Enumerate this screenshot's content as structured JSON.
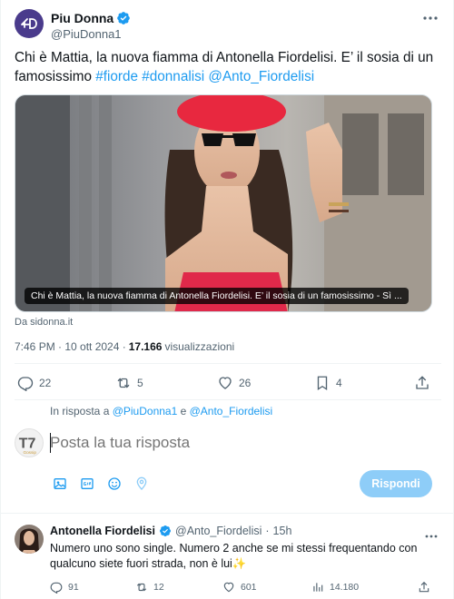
{
  "post": {
    "author_name": "Piu Donna",
    "author_handle": "@PiuDonna1",
    "text_plain": "Chi è Mattia, la nuova fiamma di Antonella Fiordelisi. E’ il sosia di un famosissimo ",
    "tags": [
      "#fiorde",
      "#donnalisi",
      "@Anto_Fiordelisi"
    ],
    "media_caption": "Chi è Mattia, la nuova fiamma di Antonella Fiordelisi. E’ il sosia di un famosissimo - Sì ...",
    "source": "Da sidonna.it",
    "time": "7:46 PM · 10 ott 2024 · ",
    "views_count": "17.166",
    "views_label": "visualizzazioni"
  },
  "actions": {
    "replies": "22",
    "reposts": "5",
    "likes": "26",
    "bookmarks": "4"
  },
  "reply_context": {
    "prefix": "In risposta a ",
    "user1": "@PiuDonna1",
    "conj": " e ",
    "user2": "@Anto_Fiordelisi"
  },
  "compose": {
    "placeholder": "Posta la tua risposta",
    "button_label": "Rispondi",
    "avatar_label": "T7",
    "avatar_sublabel": "Gossip"
  },
  "reply": {
    "author_name": "Antonella Fiordelisi",
    "author_handle": "@Anto_Fiordelisi",
    "separator": " · ",
    "age": "15h",
    "text": "Numero uno sono single. Numero 2 anche se mi stessi frequentando con qualcuno siete fuori strada, non è lui✨",
    "replies": "91",
    "reposts": "12",
    "likes": "601",
    "views": "14.180"
  },
  "colors": {
    "accent": "#1d9bf0",
    "verified": "#1d9bf0",
    "reply_button": "#8ecdf8",
    "brand_avatar": "#4a3b8c"
  }
}
